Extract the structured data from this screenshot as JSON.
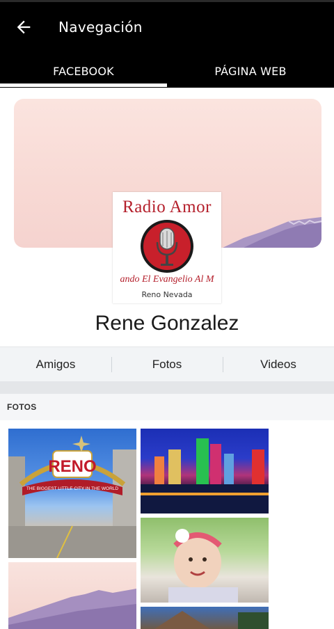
{
  "appbar": {
    "title": "Navegación",
    "back_icon": "arrow-left-icon"
  },
  "tabs": [
    {
      "label": "FACEBOOK",
      "selected": true
    },
    {
      "label": "PÁGINA WEB",
      "selected": false
    }
  ],
  "profile": {
    "name": "Rene Gonzalez",
    "logo": {
      "top_text": "Radio Amor",
      "sub_text": "ando El Evangelio Al M",
      "place_text": "Reno Nevada"
    }
  },
  "profile_tabs": [
    "Amigos",
    "Fotos",
    "Videos"
  ],
  "photos_section": {
    "label": "FOTOS",
    "reno_sign": {
      "name": "RENO",
      "slogan": "THE BIGGEST LITTLE CITY IN THE WORLD"
    }
  },
  "colors": {
    "appbar_bg": "#000000",
    "accent_red": "#b41f2b",
    "tab_text": "#ffffff"
  }
}
